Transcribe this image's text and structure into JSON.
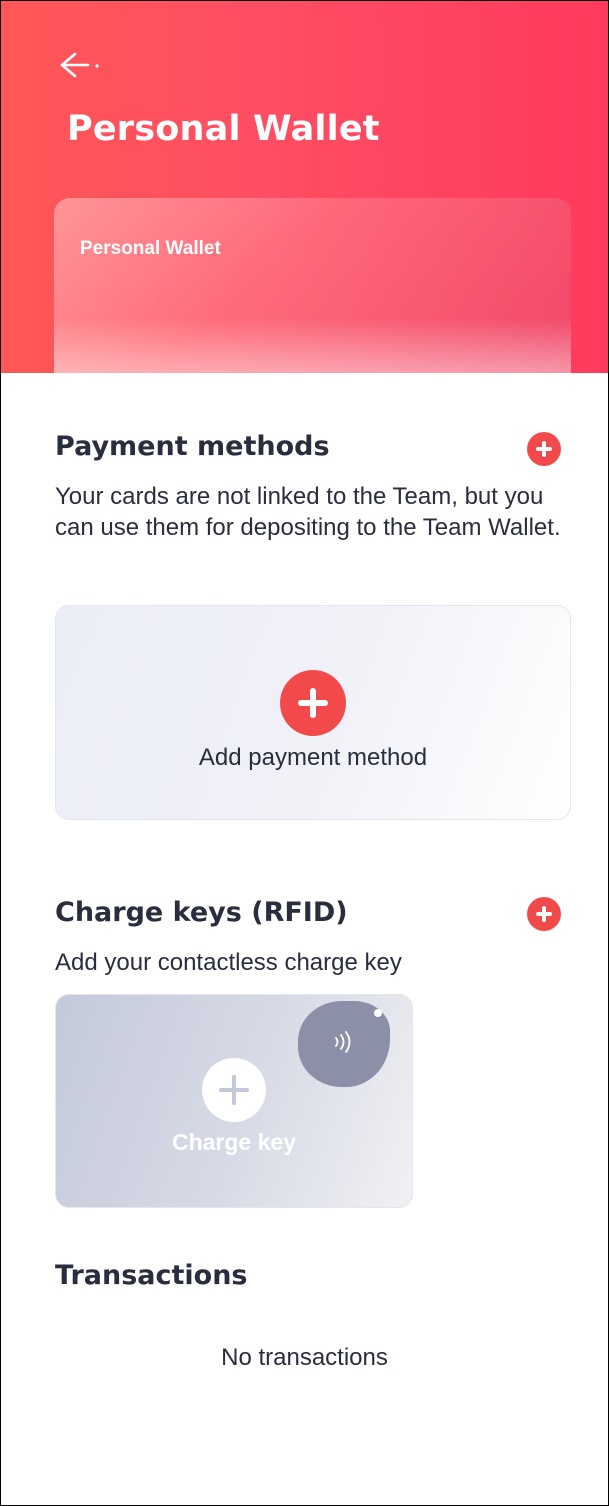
{
  "header": {
    "title": "Personal Wallet",
    "back_icon": "back-arrow-icon",
    "gradient_start": "#ff5757",
    "gradient_end": "#ff3a5e"
  },
  "wallet_card": {
    "label": "Personal Wallet"
  },
  "payment_methods": {
    "title": "Payment methods",
    "add_icon": "plus-circle-icon",
    "description": "Your cards are not linked to the Team, but you can use them for depositing to the Team Wallet.",
    "add_card_label": "Add payment method"
  },
  "charge_keys": {
    "title": "Charge keys (RFID)",
    "add_icon": "plus-circle-icon",
    "description": "Add your contactless charge key",
    "card_label": "Charge key",
    "fob_icon": "rfid-key-fob-icon"
  },
  "transactions": {
    "title": "Transactions",
    "empty_text": "No transactions"
  },
  "colors": {
    "accent": "#f24a4a",
    "text": "#2a2d3e",
    "card_bg": "#eceef6"
  }
}
